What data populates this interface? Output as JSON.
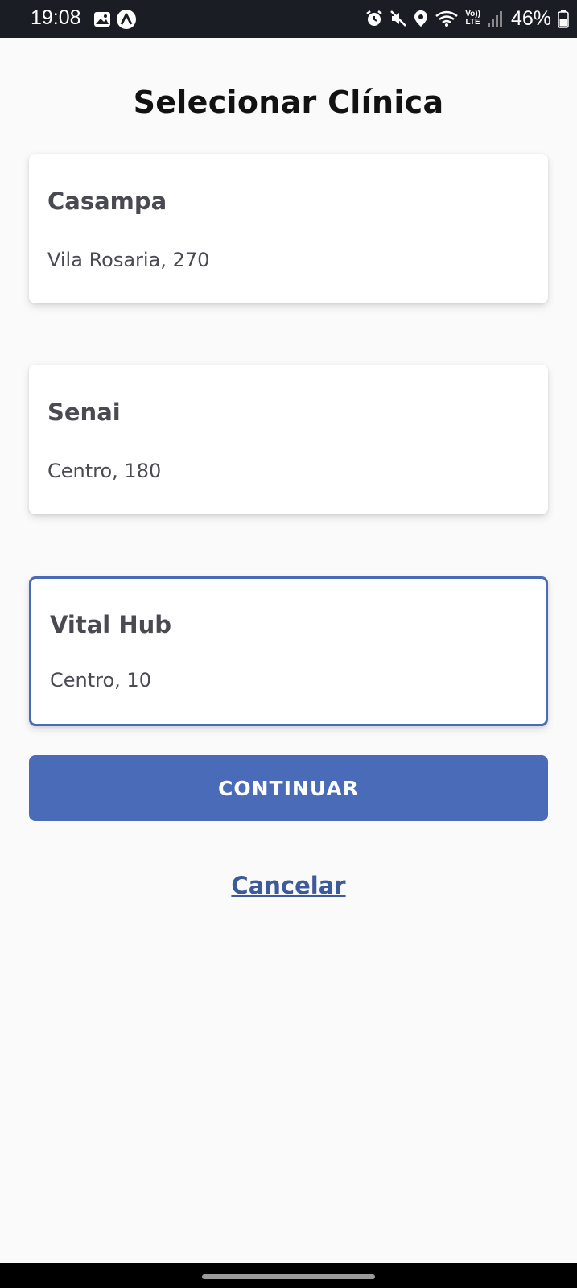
{
  "status_bar": {
    "time": "19:08",
    "battery": "46%",
    "network_top": "Vo))",
    "network_bottom": "LTE",
    "icons": [
      "image-icon",
      "app-notification-icon",
      "alarm-icon",
      "mute-icon",
      "location-icon",
      "wifi-icon",
      "signal-icon",
      "battery-icon"
    ]
  },
  "page": {
    "title": "Selecionar Clínica"
  },
  "clinics": [
    {
      "name": "Casampa",
      "address": "Vila Rosaria, 270",
      "selected": false
    },
    {
      "name": "Senai",
      "address": "Centro, 180",
      "selected": false
    },
    {
      "name": "Vital Hub",
      "address": "Centro, 10",
      "selected": true
    }
  ],
  "actions": {
    "continue_label": "Continuar",
    "cancel_label": "Cancelar"
  },
  "colors": {
    "accent": "#4a6bb8",
    "link": "#3d5a9a",
    "text": "#4a4a52",
    "title": "#121212",
    "status_bar": "#1a1d24"
  }
}
